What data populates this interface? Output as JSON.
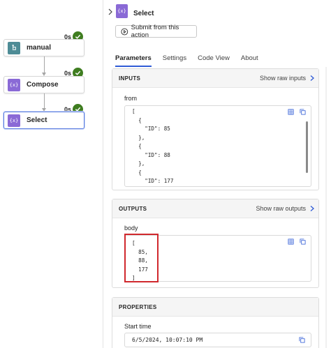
{
  "flow": {
    "nodes": [
      {
        "label": "manual",
        "status": "0s"
      },
      {
        "label": "Compose",
        "status": "0s"
      },
      {
        "label": "Select",
        "status": "0s"
      }
    ]
  },
  "panel": {
    "title": "Select",
    "submit_label": "Submit from this action",
    "tabs": [
      {
        "label": "Parameters",
        "active": true
      },
      {
        "label": "Settings"
      },
      {
        "label": "Code View"
      },
      {
        "label": "About"
      }
    ],
    "inputs": {
      "heading": "INPUTS",
      "raw_link": "Show raw inputs",
      "field_label": "from",
      "code": "[\n  {\n    \"ID\": 85\n  },\n  {\n    \"ID\": 88\n  },\n  {\n    \"ID\": 177\n  }"
    },
    "outputs": {
      "heading": "OUTPUTS",
      "raw_link": "Show raw outputs",
      "field_label": "body",
      "code": "[\n  85,\n  88,\n  177\n]"
    },
    "properties": {
      "heading": "PROPERTIES",
      "field_label": "Start time",
      "start_time": "6/5/2024, 10:07:10 PM"
    }
  },
  "colors": {
    "accent": "#2f5bd6",
    "success": "#3f7d20",
    "action_purple": "#8a6ad6",
    "trigger_teal": "#4e8c96",
    "highlight_red": "#d0282d"
  },
  "icons": [
    "manual-trigger-icon",
    "compose-icon",
    "select-icon",
    "success-check-icon",
    "chevron-right-icon",
    "run-icon",
    "copy-icon",
    "table-view-icon",
    "calendar-icon"
  ]
}
